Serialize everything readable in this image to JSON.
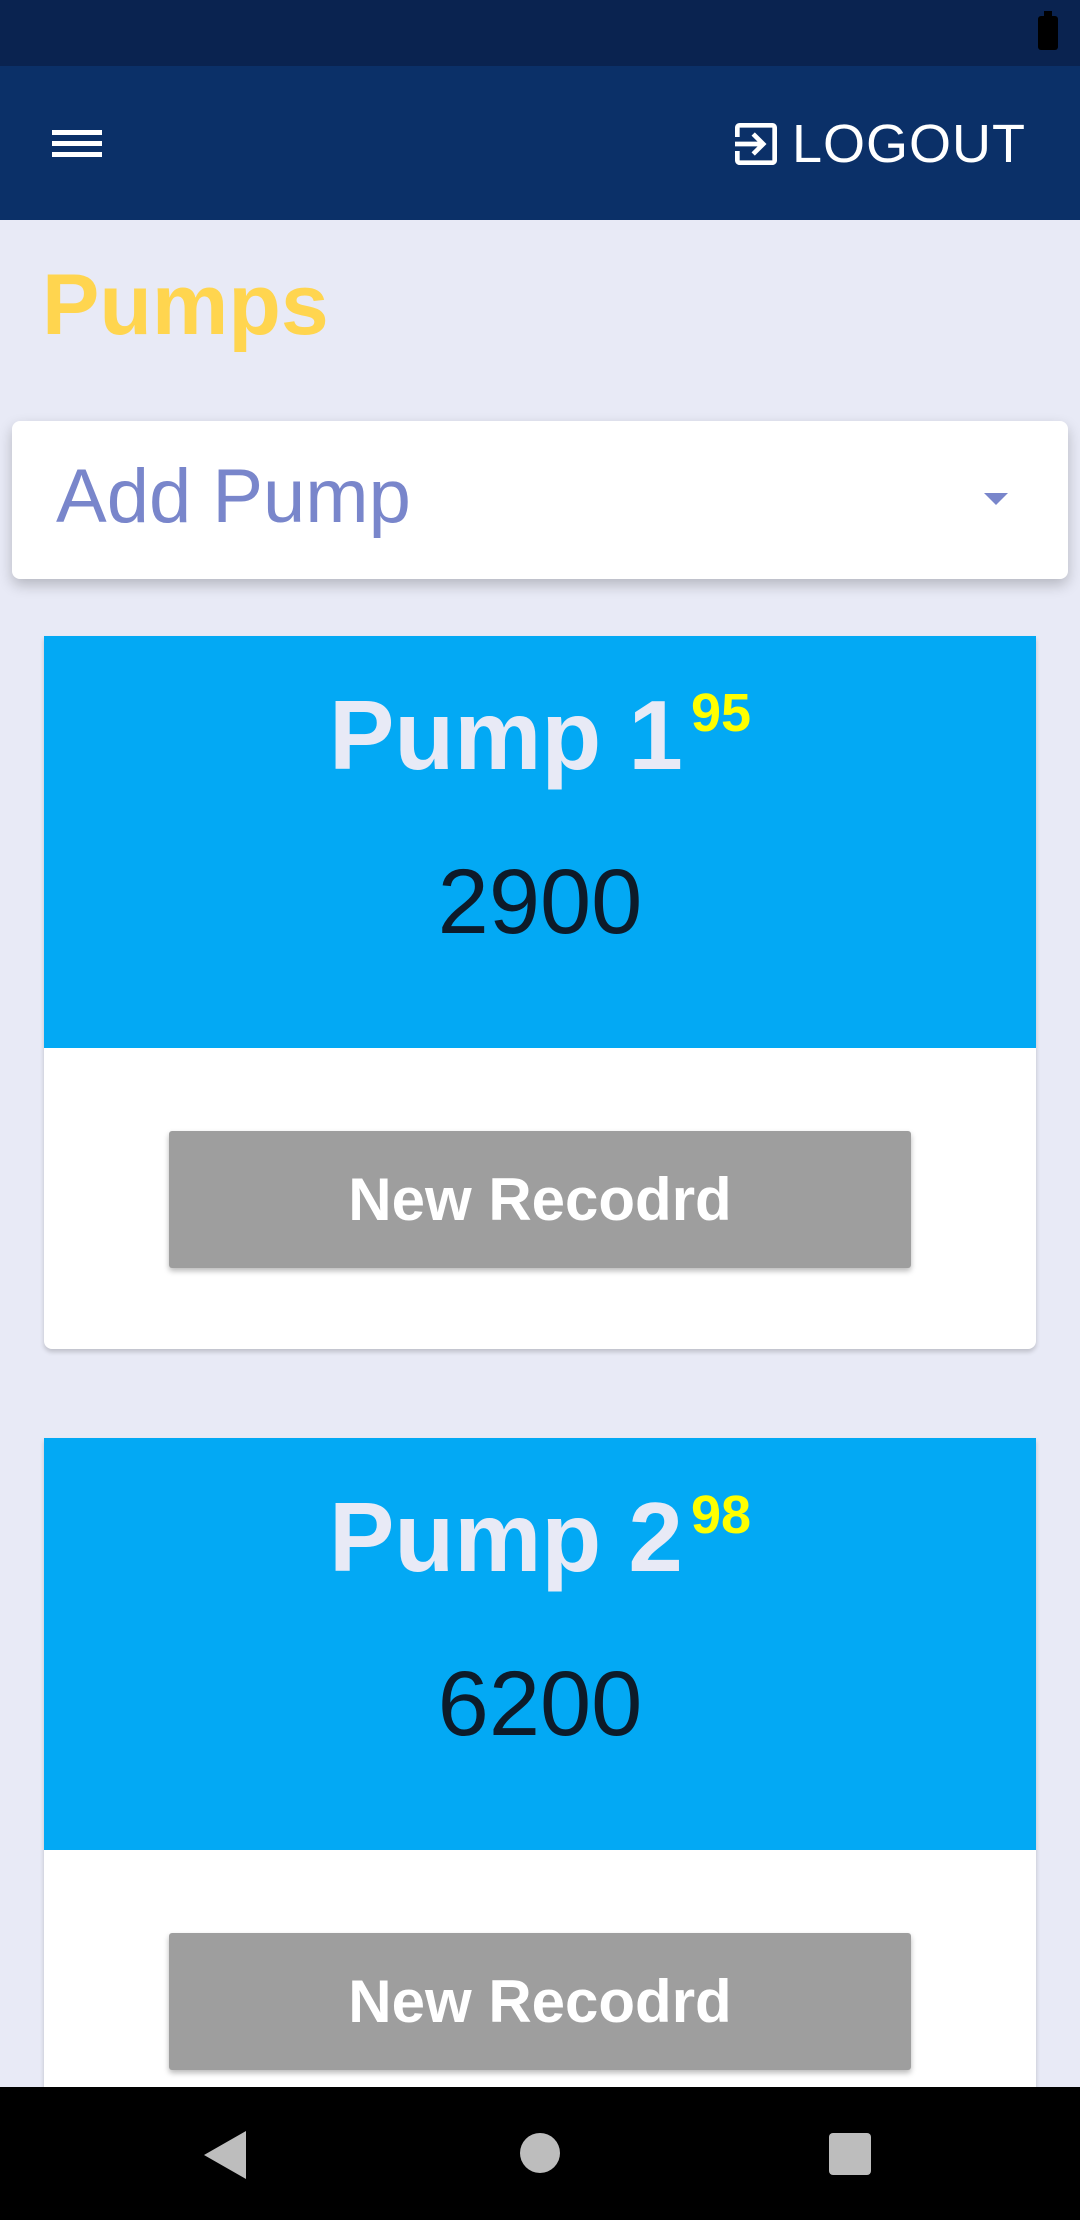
{
  "app_bar": {
    "logout_label": "LOGOUT"
  },
  "page": {
    "title": "Pumps"
  },
  "select": {
    "value": "Add Pump"
  },
  "pumps": [
    {
      "name": "Pump 1",
      "badge": "95",
      "reading": "2900",
      "button_label": "New Recodrd"
    },
    {
      "name": "Pump 2",
      "badge": "98",
      "reading": "6200",
      "button_label": "New Recodrd"
    }
  ],
  "icons": [
    "menu-icon",
    "logout-icon",
    "dropdown-arrow-icon",
    "battery-icon",
    "back-icon",
    "home-icon",
    "recents-icon"
  ],
  "colors": {
    "app_bar": "#0b3068",
    "title": "#ffd54f",
    "card_header": "#03a9f4",
    "badge": "#ffff00",
    "button": "#9e9e9e"
  }
}
